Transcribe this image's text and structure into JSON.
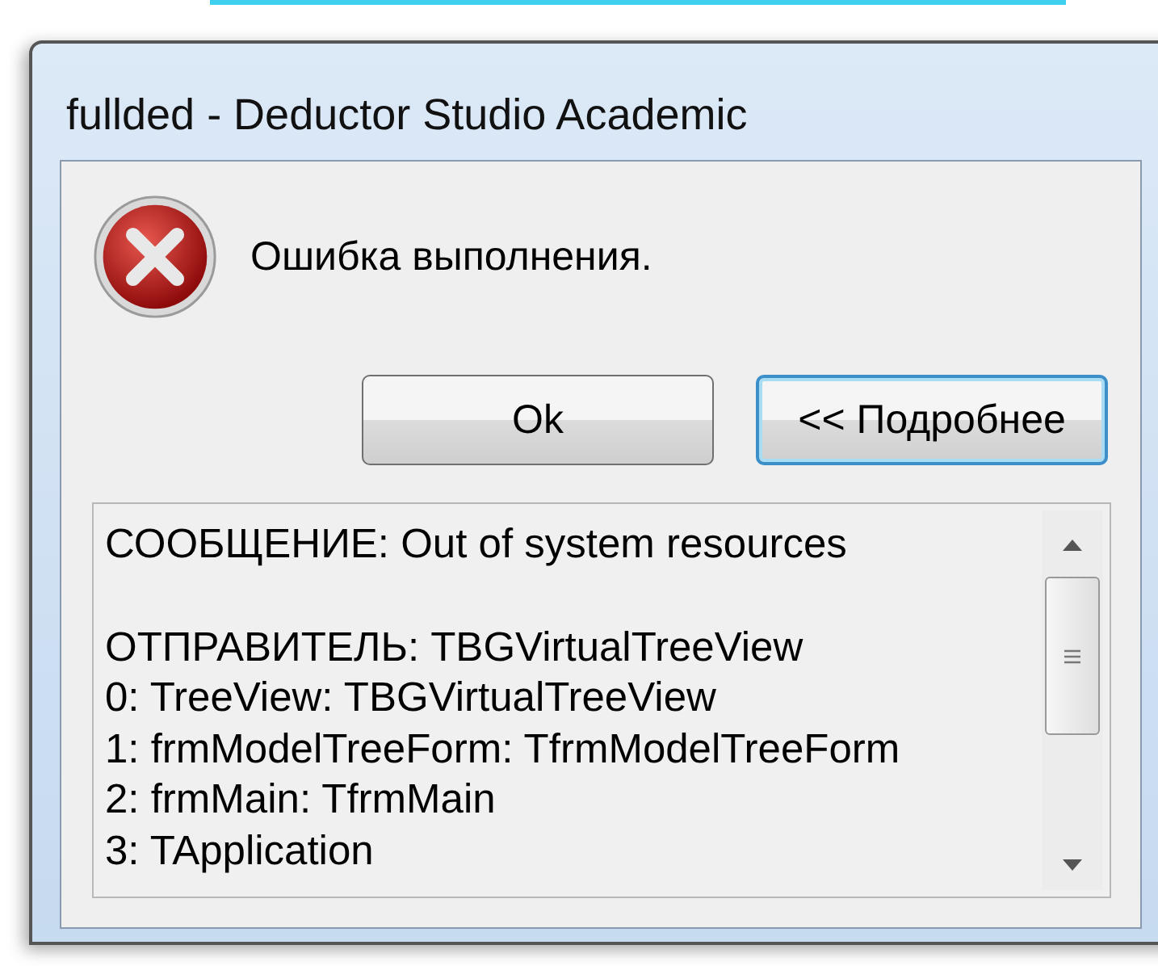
{
  "window": {
    "title": "fullded - Deductor Studio Academic"
  },
  "message": "Ошибка выполнения.",
  "buttons": [
    {
      "label": "Ok",
      "focused": false
    },
    {
      "label": "<< Подробнее",
      "focused": true
    }
  ],
  "details": {
    "paragraphs": [
      {
        "lines": [
          "СООБЩЕНИЕ: Out of system resources"
        ]
      },
      {
        "lines": [
          "ОТПРАВИТЕЛЬ: TBGVirtualTreeView",
          "0: TreeView: TBGVirtualTreeView",
          "1: frmModelTreeForm: TfrmModelTreeForm",
          "2: frmMain: TfrmMain",
          "3: TApplication"
        ]
      }
    ]
  }
}
